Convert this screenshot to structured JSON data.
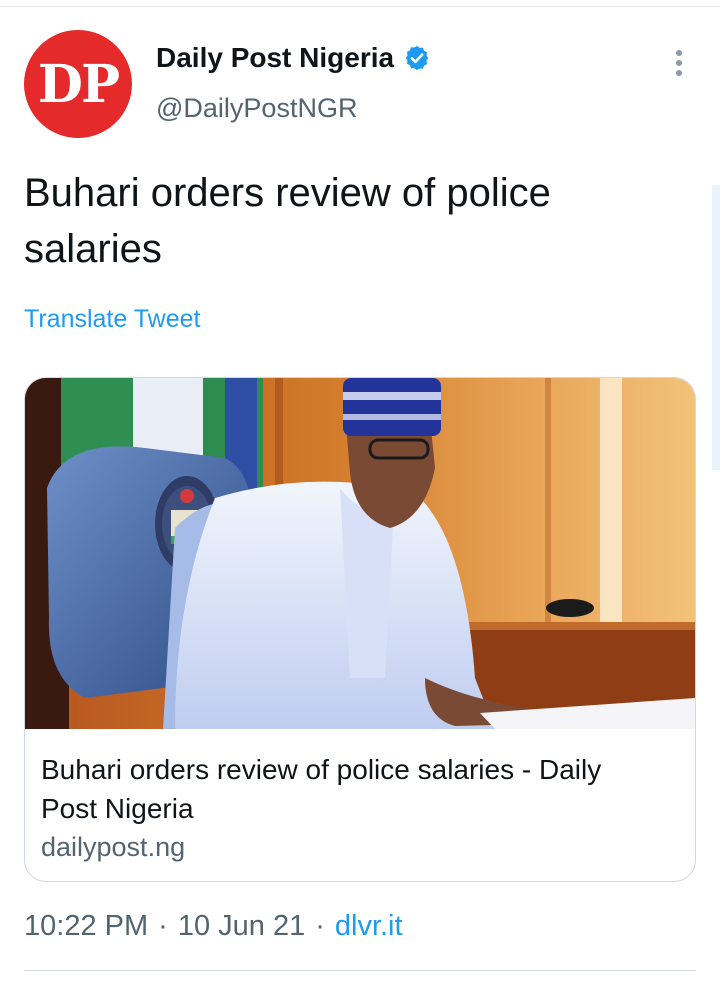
{
  "account": {
    "avatar_initials": "DP",
    "name": "Daily Post Nigeria",
    "handle": "@DailyPostNGR",
    "verified_icon": "verified-badge-icon",
    "brand_color": "#e42a2a"
  },
  "tweet": {
    "text": "Buhari orders review of police salaries",
    "translate_label": "Translate Tweet"
  },
  "link_card": {
    "image_icon": "article-photo",
    "title": "Buhari orders review of police salaries - Daily Post Nigeria",
    "domain": "dailypost.ng"
  },
  "meta": {
    "time": "10:22 PM",
    "separator": "·",
    "date": "10 Jun 21",
    "source": "dlvr.it"
  },
  "colors": {
    "link_blue": "#1d9bf0",
    "secondary_text": "#536471",
    "border": "#cfd9de"
  }
}
